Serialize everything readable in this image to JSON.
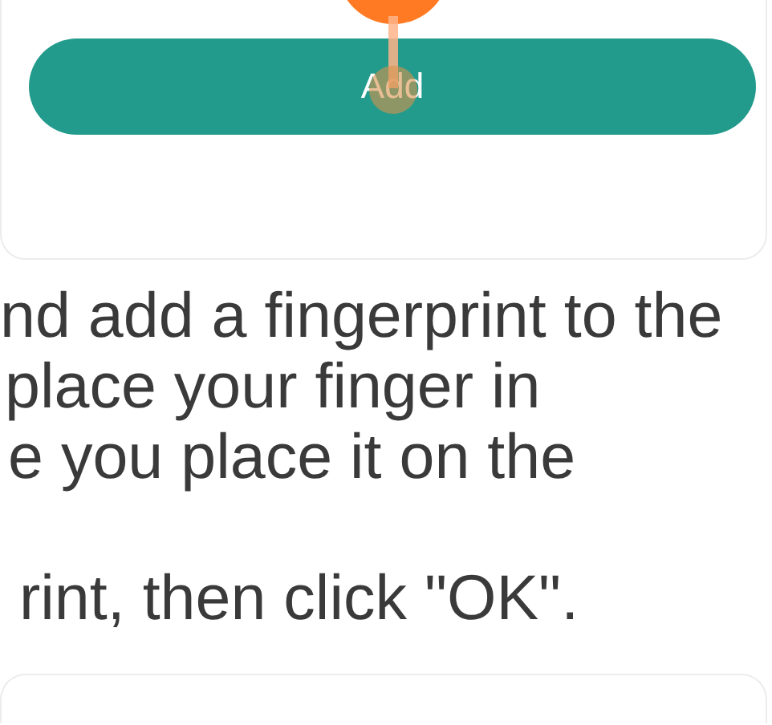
{
  "card": {
    "button": "Add"
  },
  "instructions": {
    "paragraphs": [
      [
        "nd add a fingerprint to the",
        "place your finger in",
        "e you place it on the"
      ],
      [
        "rint, then click \"OK\"."
      ]
    ]
  }
}
